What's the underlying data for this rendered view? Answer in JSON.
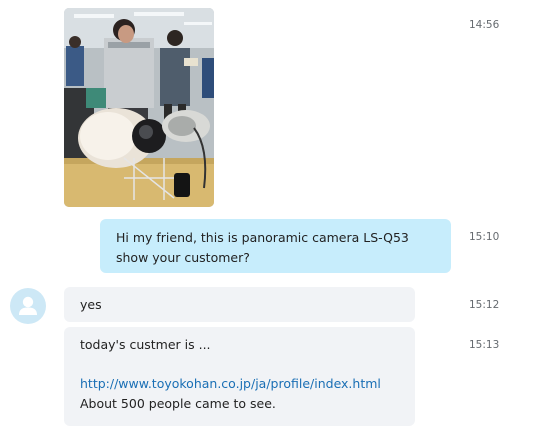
{
  "messages": {
    "photo": {
      "time": "14:56",
      "alt_icon": "photo-attachment"
    },
    "outgoing": {
      "line1": "Hi my friend, this is panoramic camera LS-Q53",
      "line2": "show your customer?",
      "time": "15:10"
    },
    "incoming_1": {
      "text": "yes",
      "time": "15:12"
    },
    "incoming_2": {
      "line1": "today's custmer is ...",
      "link": "http://www.toyokohan.co.jp/ja/profile/index.html",
      "line3": "About 500 people came to see.",
      "time": "15:13"
    }
  },
  "contact": {
    "avatar_icon": "default-user-avatar"
  },
  "colors": {
    "outgoing_bubble": "#c7edfc",
    "incoming_bubble": "#f1f3f6",
    "link": "#1a6fb5",
    "timestamp": "#666b70",
    "avatar_bg": "#cde8f6"
  }
}
